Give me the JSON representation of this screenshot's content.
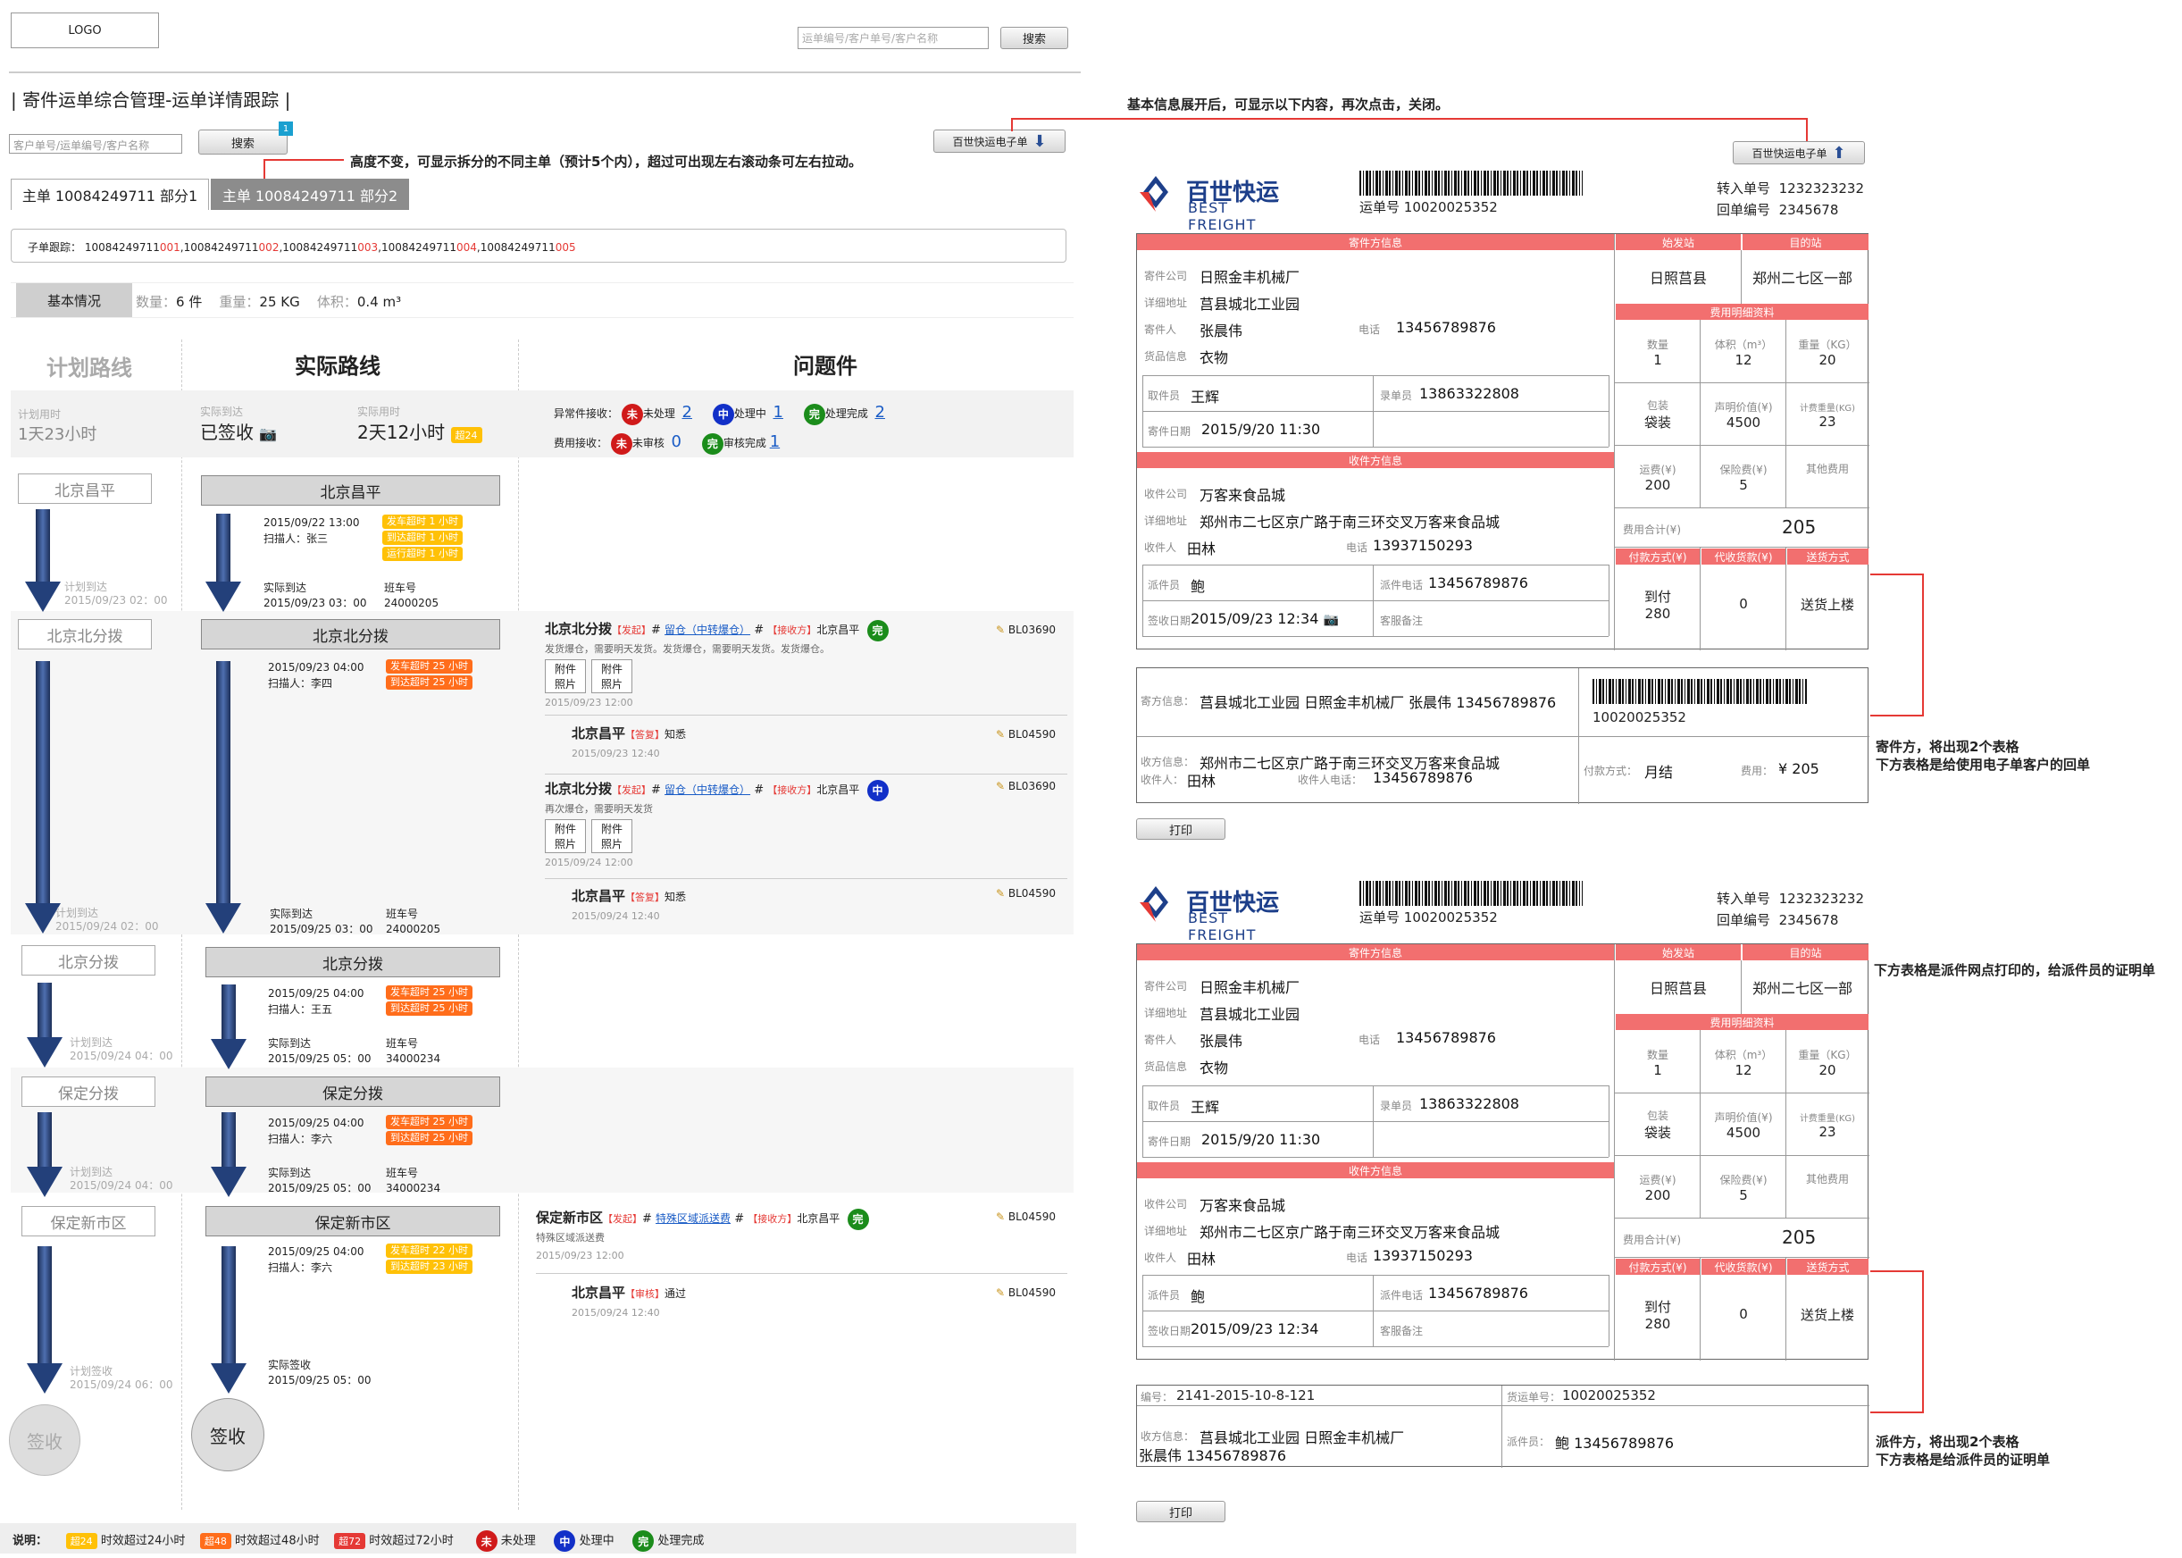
{
  "header": {
    "logo": "LOGO",
    "search_placeholder": "运单编号/客户单号/客户名称",
    "search_btn": "搜索"
  },
  "page_title": "| 寄件运单综合管理-运单详情跟踪 |",
  "sub_search": {
    "placeholder": "客户单号/运单编号/客户名称",
    "btn": "搜索",
    "badge": "1"
  },
  "e_waybill_btn": "百世快运电子单",
  "note_top": "高度不变，可显示拆分的不同主单（预计5个内），超过可出现左右滚动条可左右拉动。",
  "note_expand": "基本信息展开后，可显示以下内容，再次点击，关闭。",
  "tabs": [
    "主单 10084249711 部分1",
    "主单 10084249711 部分2"
  ],
  "sub_orders": {
    "label": "子单跟踪：",
    "items": [
      {
        "pre": "10084249711",
        "suf": "001"
      },
      {
        "pre": "10084249711",
        "suf": "002"
      },
      {
        "pre": "10084249711",
        "suf": "003"
      },
      {
        "pre": "10084249711",
        "suf": "004"
      },
      {
        "pre": "10084249711",
        "suf": "005"
      }
    ],
    "sep": ","
  },
  "basic": {
    "tab": "基本情况",
    "qty_l": "数量：",
    "qty": "6 件",
    "wt_l": "重量：",
    "wt": "25 KG",
    "vol_l": "体积：",
    "vol": "0.4 m³"
  },
  "cols": {
    "plan": "计划路线",
    "actual": "实际路线",
    "issue": "问题件"
  },
  "summary": {
    "plan_l": "计划用时",
    "plan_v": "1天23小时",
    "arr_l": "实际到达",
    "arr_v": "已签收",
    "used_l": "实际用时",
    "used_v": "2天12小时",
    "used_tag": "超24",
    "exc_l": "异常件接收：",
    "s1": "未",
    "s1l": "未处理",
    "s1n": "2",
    "s2": "中",
    "s2l": "处理中",
    "s2n": "1",
    "s3": "完",
    "s3l": "处理完成",
    "s3n": "2",
    "fee_l": "费用接收：",
    "f1l": "未审核",
    "f1n": "0",
    "f2l": "审核完成",
    "f2n": "1"
  },
  "plan_nodes": [
    {
      "name": "北京昌平",
      "arr_l": "计划到达",
      "arr": "2015/09/23 02：00"
    },
    {
      "name": "北京北分拨",
      "arr_l": "计划到达",
      "arr": "2015/09/24 02：00"
    },
    {
      "name": "北京分拨",
      "arr_l": "计划到达",
      "arr": "2015/09/24 04：00"
    },
    {
      "name": "保定分拨",
      "arr_l": "计划到达",
      "arr": "2015/09/24 04：00"
    },
    {
      "name": "保定新市区",
      "arr_l": "计划签收",
      "arr": "2015/09/24 06：00"
    }
  ],
  "sign": "签收",
  "actual_nodes": [
    {
      "name": "北京昌平",
      "time": "2015/09/22 13:00",
      "scan": "扫描人：张三",
      "tags": [
        "发车超时 1 小时",
        "到达超时 1 小时",
        "运行超时 1 小时"
      ],
      "arr_l": "实际到达",
      "arr": "2015/09/23 03：00",
      "bus_l": "班车号",
      "bus": "24000205"
    },
    {
      "name": "北京北分拨",
      "time": "2015/09/23 04:00",
      "scan": "扫描人：李四",
      "tags": [
        "发车超时 25 小时",
        "到达超时 25 小时"
      ],
      "arr_l": "实际到达",
      "arr": "2015/09/25 03：00",
      "bus_l": "班车号",
      "bus": "24000205"
    },
    {
      "name": "北京分拨",
      "time": "2015/09/25 04:00",
      "scan": "扫描人：王五",
      "tags": [
        "发车超时 25 小时",
        "到达超时 25 小时"
      ],
      "arr_l": "实际到达",
      "arr": "2015/09/25 05：00",
      "bus_l": "班车号",
      "bus": "34000234"
    },
    {
      "name": "保定分拨",
      "time": "2015/09/25 04:00",
      "scan": "扫描人：李六",
      "tags": [
        "发车超时 25 小时",
        "到达超时 25 小时"
      ],
      "arr_l": "实际到达",
      "arr": "2015/09/25 05：00",
      "bus_l": "班车号",
      "bus": "34000234"
    },
    {
      "name": "保定新市区",
      "time": "2015/09/25 04:00",
      "scan": "扫描人：李六",
      "tags": [
        "发车超时 22 小时",
        "到达超时 23 小时"
      ],
      "arr_l": "实际签收",
      "arr": "2015/09/25 05：00"
    }
  ],
  "issues": [
    {
      "site": "北京北分拨",
      "t1": "【发起】",
      "link": "留仓（中转爆仓）",
      "t2": "【接收方】",
      "recv": "北京昌平",
      "st": "完",
      "code": "BL03690",
      "desc": "发货爆仓，需要明天发货。发货爆仓，需要明天发货。发货爆仓。",
      "att": "附件\n照片",
      "date": "2015/09/23 12:00"
    },
    {
      "site": "北京昌平",
      "t1": "【答复】",
      "reply": "知悉",
      "code": "BL04590",
      "date": "2015/09/23 12:40"
    },
    {
      "site": "北京北分拨",
      "t1": "【发起】",
      "link": "留仓（中转爆仓）",
      "t2": "【接收方】",
      "recv": "北京昌平",
      "st": "中",
      "code": "BL03690",
      "desc": "再次爆仓，需要明天发货",
      "date": "2015/09/24 12:00"
    },
    {
      "site": "北京昌平",
      "t1": "【答复】",
      "reply": "知悉",
      "code": "BL04590",
      "date": "2015/09/24 12:40"
    },
    {
      "site": "保定新市区",
      "t1": "【发起】",
      "link": "特殊区域派送费",
      "t2": "【接收方】",
      "recv": "北京昌平",
      "st": "完",
      "code": "BL04590",
      "desc": "特殊区域派送费",
      "date": "2015/09/23 12:00"
    },
    {
      "site": "北京昌平",
      "t1": "【审核】",
      "reply": "通过",
      "code": "BL04590",
      "date": "2015/09/24 12:40"
    }
  ],
  "attach": [
    "附件",
    "照片"
  ],
  "legend": {
    "title": "说明：",
    "a": "超24",
    "al": "时效超过24小时",
    "b": "超48",
    "bl": "时效超过48小时",
    "c": "超72",
    "cl": "时效超过72小时",
    "d": "未",
    "dl": "未处理",
    "e": "中",
    "el": "处理中",
    "f": "完",
    "fl": "处理完成"
  },
  "form": {
    "brand_cn": "百世快运",
    "brand_en": "BEST FREIGHT",
    "waybill_l": "运单号",
    "waybill": "10020025352",
    "transfer_l": "转入单号",
    "transfer": "1232323232",
    "return_l": "回单编号",
    "return": "2345678",
    "sender_h": "寄件方信息",
    "from_h": "始发站",
    "to_h": "目的站",
    "from": "日照莒县",
    "to": "郑州二七区一部",
    "company_l": "寄件公司",
    "company": "日照金丰机械厂",
    "addr_l": "详细地址",
    "addr": "莒县城北工业园",
    "person_l": "寄件人",
    "person": "张晨伟",
    "phone_l": "电话",
    "phone": "13456789876",
    "goods_l": "货品信息",
    "goods": "衣物",
    "fee_h": "费用明细资料",
    "qty_l": "数量",
    "qty": "1",
    "vol_l": "体积（m³）",
    "vol": "12",
    "wt_l": "重量（KG）",
    "wt": "20",
    "pack_l": "包装",
    "pack": "袋装",
    "decl_l": "声明价值(¥)",
    "decl": "4500",
    "cwt_l": "计费重量(KG)",
    "cwt": "23",
    "freight_l": "运费(¥)",
    "freight": "200",
    "ins_l": "保险费(¥)",
    "ins": "5",
    "other_l": "其他费用",
    "total_l": "费用合计(¥)",
    "total": "205",
    "pay_h": "付款方式(¥)",
    "cod_h": "代收货款(¥)",
    "del_h": "送货方式",
    "pay": "到付\n280",
    "cod": "0",
    "del": "送货上楼",
    "picker_l": "取件员",
    "picker": "王辉",
    "rec_l": "录单员",
    "rec": "13863322808",
    "pdate_l": "寄件日期",
    "pdate": "2015/9/20 11:30",
    "recv_h": "收件方信息",
    "rcomp_l": "收件公司",
    "rcomp": "万客来食品城",
    "raddr_l": "详细地址",
    "raddr": "郑州市二七区京广路于南三环交叉万客来食品城",
    "rperson_l": "收件人",
    "rperson": "田林",
    "rphone_l": "电话",
    "rphone": "13937150293",
    "courier_l": "派件员",
    "courier": "鲍",
    "dphone_l": "派件电话",
    "dphone": "13456789876",
    "sdate_l": "签收日期",
    "sdate": "2015/09/23 12:34",
    "remark_l": "客服备注",
    "s_info_l": "寄方信息：",
    "s_info": "莒县城北工业园 日照金丰机械厂 张晨伟 13456789876",
    "r_info_l": "收方信息：",
    "r_info": "郑州市二七区京广路于南三环交叉万客来食品城",
    "r_person_l": "收件人：",
    "r_person": "田林",
    "r_phone_l": "收件人电话：",
    "r_phone": "13456789876",
    "paym_l": "付款方式：",
    "paym": "月结",
    "fee2_l": "费用：",
    "fee2": "¥ 205",
    "barcode_num": "10020025352",
    "num_l": "编号：",
    "num": "2141-2015-10-8-121",
    "wb2_l": "货运单号：",
    "wb2": "10020025352",
    "sinfo2": "莒县城北工业园 日照金丰机械厂",
    "sinfo2b": "张晨伟 13456789876",
    "r2_l": "收方信息：",
    "courier2_l": "派件员：",
    "courier2": "鲍 13456789876",
    "print": "打印"
  },
  "note_sender": "寄件方，将出现2个表格\n下方表格是给使用电子单客户的回单",
  "note_dispatch_top": "下方表格是派件网点打印的，给派件员的证明单",
  "note_dispatch": "派件方，将出现2个表格\n下方表格是给派件员的证明单",
  "colors": {
    "accent_red": "#e53935",
    "header_pink": "#f26f6f",
    "arrow_blue": "#23407a"
  }
}
